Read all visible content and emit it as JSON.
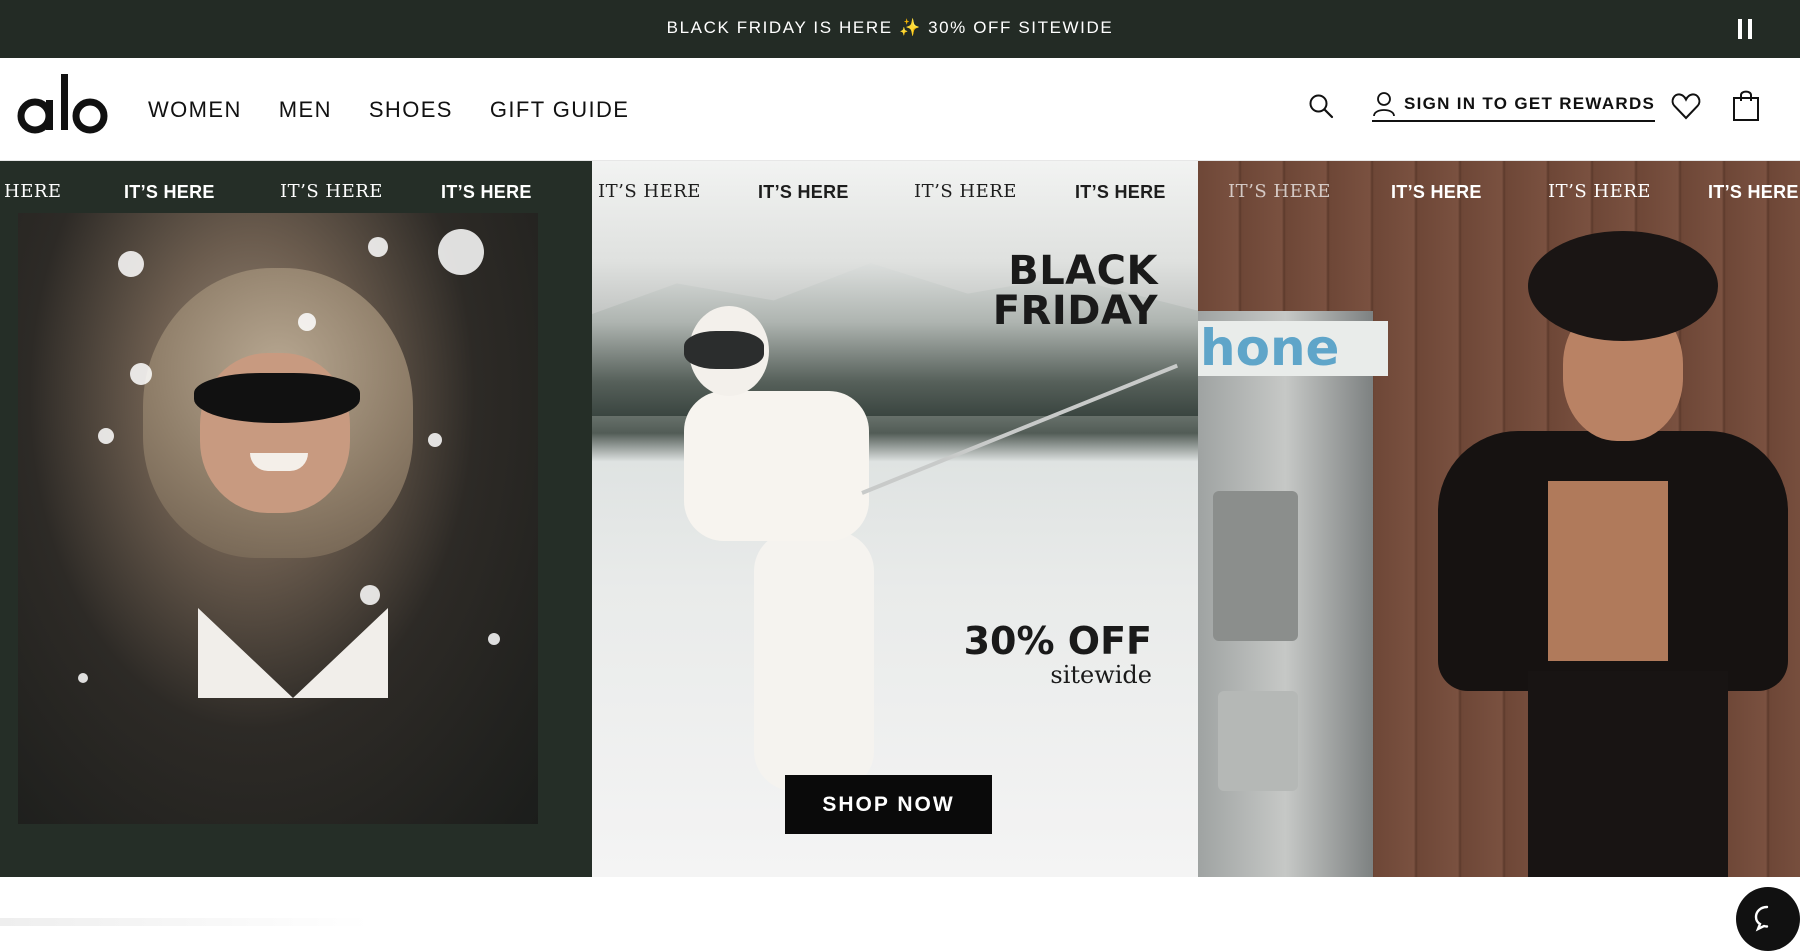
{
  "announcement": {
    "text": "BLACK FRIDAY IS HERE ✨ 30% OFF SITEWIDE",
    "pause_icon": "pause-icon"
  },
  "header": {
    "logo": "alo",
    "nav": [
      {
        "label": "WOMEN"
      },
      {
        "label": "MEN"
      },
      {
        "label": "SHOES"
      },
      {
        "label": "GIFT GUIDE"
      }
    ],
    "sign_in_label": "SIGN IN TO GET REWARDS",
    "icons": [
      "search-icon",
      "user-icon",
      "heart-icon",
      "bag-icon"
    ]
  },
  "hero": {
    "ticker_serif": "IT’S HERE",
    "ticker_bold": "IT’S HERE",
    "ticker_partial": "HERE",
    "headline_line1": "BLACK",
    "headline_line2": "FRIDAY",
    "discount": "30% OFF",
    "discount_sub": "sitewide",
    "cta_label": "SHOP NOW",
    "booth_sign": "hone"
  },
  "colors": {
    "announcement_bg": "#232b25",
    "panel_left_bg": "#252e27",
    "cta_bg": "#0a0a0a"
  }
}
